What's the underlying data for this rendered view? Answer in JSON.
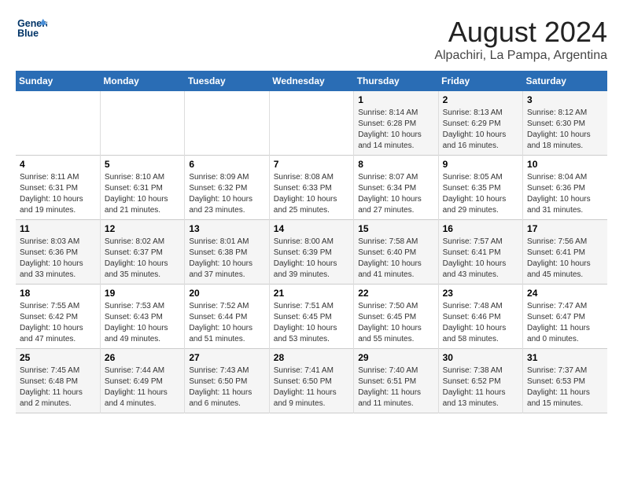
{
  "logo": {
    "line1": "General",
    "line2": "Blue"
  },
  "title": "August 2024",
  "location": "Alpachiri, La Pampa, Argentina",
  "headers": [
    "Sunday",
    "Monday",
    "Tuesday",
    "Wednesday",
    "Thursday",
    "Friday",
    "Saturday"
  ],
  "weeks": [
    [
      {
        "day": "",
        "info": ""
      },
      {
        "day": "",
        "info": ""
      },
      {
        "day": "",
        "info": ""
      },
      {
        "day": "",
        "info": ""
      },
      {
        "day": "1",
        "info": "Sunrise: 8:14 AM\nSunset: 6:28 PM\nDaylight: 10 hours\nand 14 minutes."
      },
      {
        "day": "2",
        "info": "Sunrise: 8:13 AM\nSunset: 6:29 PM\nDaylight: 10 hours\nand 16 minutes."
      },
      {
        "day": "3",
        "info": "Sunrise: 8:12 AM\nSunset: 6:30 PM\nDaylight: 10 hours\nand 18 minutes."
      }
    ],
    [
      {
        "day": "4",
        "info": "Sunrise: 8:11 AM\nSunset: 6:31 PM\nDaylight: 10 hours\nand 19 minutes."
      },
      {
        "day": "5",
        "info": "Sunrise: 8:10 AM\nSunset: 6:31 PM\nDaylight: 10 hours\nand 21 minutes."
      },
      {
        "day": "6",
        "info": "Sunrise: 8:09 AM\nSunset: 6:32 PM\nDaylight: 10 hours\nand 23 minutes."
      },
      {
        "day": "7",
        "info": "Sunrise: 8:08 AM\nSunset: 6:33 PM\nDaylight: 10 hours\nand 25 minutes."
      },
      {
        "day": "8",
        "info": "Sunrise: 8:07 AM\nSunset: 6:34 PM\nDaylight: 10 hours\nand 27 minutes."
      },
      {
        "day": "9",
        "info": "Sunrise: 8:05 AM\nSunset: 6:35 PM\nDaylight: 10 hours\nand 29 minutes."
      },
      {
        "day": "10",
        "info": "Sunrise: 8:04 AM\nSunset: 6:36 PM\nDaylight: 10 hours\nand 31 minutes."
      }
    ],
    [
      {
        "day": "11",
        "info": "Sunrise: 8:03 AM\nSunset: 6:36 PM\nDaylight: 10 hours\nand 33 minutes."
      },
      {
        "day": "12",
        "info": "Sunrise: 8:02 AM\nSunset: 6:37 PM\nDaylight: 10 hours\nand 35 minutes."
      },
      {
        "day": "13",
        "info": "Sunrise: 8:01 AM\nSunset: 6:38 PM\nDaylight: 10 hours\nand 37 minutes."
      },
      {
        "day": "14",
        "info": "Sunrise: 8:00 AM\nSunset: 6:39 PM\nDaylight: 10 hours\nand 39 minutes."
      },
      {
        "day": "15",
        "info": "Sunrise: 7:58 AM\nSunset: 6:40 PM\nDaylight: 10 hours\nand 41 minutes."
      },
      {
        "day": "16",
        "info": "Sunrise: 7:57 AM\nSunset: 6:41 PM\nDaylight: 10 hours\nand 43 minutes."
      },
      {
        "day": "17",
        "info": "Sunrise: 7:56 AM\nSunset: 6:41 PM\nDaylight: 10 hours\nand 45 minutes."
      }
    ],
    [
      {
        "day": "18",
        "info": "Sunrise: 7:55 AM\nSunset: 6:42 PM\nDaylight: 10 hours\nand 47 minutes."
      },
      {
        "day": "19",
        "info": "Sunrise: 7:53 AM\nSunset: 6:43 PM\nDaylight: 10 hours\nand 49 minutes."
      },
      {
        "day": "20",
        "info": "Sunrise: 7:52 AM\nSunset: 6:44 PM\nDaylight: 10 hours\nand 51 minutes."
      },
      {
        "day": "21",
        "info": "Sunrise: 7:51 AM\nSunset: 6:45 PM\nDaylight: 10 hours\nand 53 minutes."
      },
      {
        "day": "22",
        "info": "Sunrise: 7:50 AM\nSunset: 6:45 PM\nDaylight: 10 hours\nand 55 minutes."
      },
      {
        "day": "23",
        "info": "Sunrise: 7:48 AM\nSunset: 6:46 PM\nDaylight: 10 hours\nand 58 minutes."
      },
      {
        "day": "24",
        "info": "Sunrise: 7:47 AM\nSunset: 6:47 PM\nDaylight: 11 hours\nand 0 minutes."
      }
    ],
    [
      {
        "day": "25",
        "info": "Sunrise: 7:45 AM\nSunset: 6:48 PM\nDaylight: 11 hours\nand 2 minutes."
      },
      {
        "day": "26",
        "info": "Sunrise: 7:44 AM\nSunset: 6:49 PM\nDaylight: 11 hours\nand 4 minutes."
      },
      {
        "day": "27",
        "info": "Sunrise: 7:43 AM\nSunset: 6:50 PM\nDaylight: 11 hours\nand 6 minutes."
      },
      {
        "day": "28",
        "info": "Sunrise: 7:41 AM\nSunset: 6:50 PM\nDaylight: 11 hours\nand 9 minutes."
      },
      {
        "day": "29",
        "info": "Sunrise: 7:40 AM\nSunset: 6:51 PM\nDaylight: 11 hours\nand 11 minutes."
      },
      {
        "day": "30",
        "info": "Sunrise: 7:38 AM\nSunset: 6:52 PM\nDaylight: 11 hours\nand 13 minutes."
      },
      {
        "day": "31",
        "info": "Sunrise: 7:37 AM\nSunset: 6:53 PM\nDaylight: 11 hours\nand 15 minutes."
      }
    ]
  ]
}
